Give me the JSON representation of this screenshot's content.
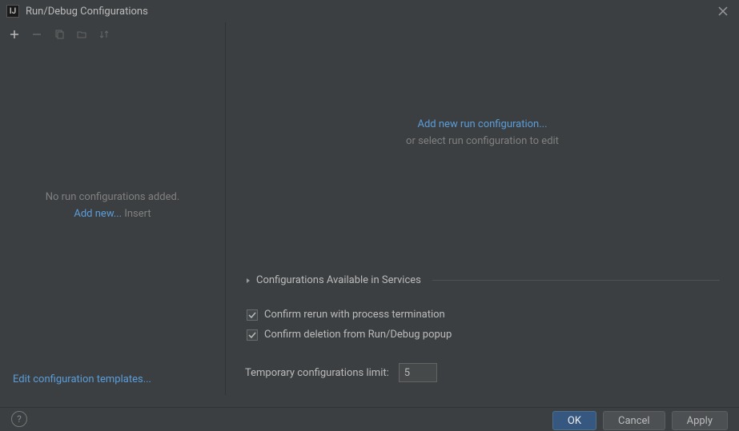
{
  "window": {
    "title": "Run/Debug Configurations"
  },
  "leftPanel": {
    "emptyMessage": "No run configurations added.",
    "addNewLabel": "Add new...",
    "addNewHint": "Insert",
    "editTemplatesLabel": "Edit configuration templates..."
  },
  "rightPanel": {
    "addNewLink": "Add new run configuration...",
    "orSelect": "or select run configuration to edit",
    "sectionTitle": "Configurations Available in Services",
    "confirmRerun": {
      "checked": true,
      "label": "Confirm rerun with process termination"
    },
    "confirmDeletion": {
      "checked": true,
      "label": "Confirm deletion from Run/Debug popup"
    },
    "tempLimitLabel": "Temporary configurations limit:",
    "tempLimitValue": "5"
  },
  "buttons": {
    "ok": "OK",
    "cancel": "Cancel",
    "apply": "Apply"
  }
}
